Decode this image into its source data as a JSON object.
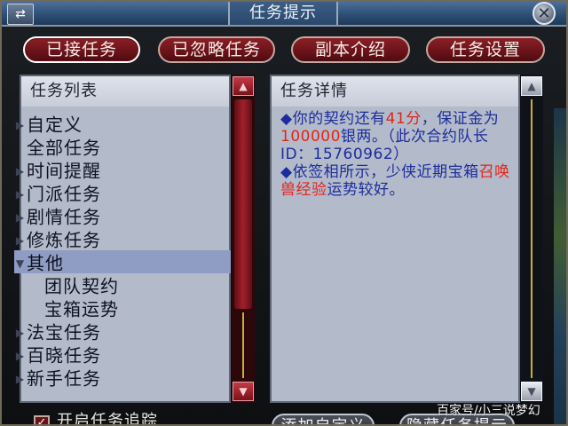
{
  "window": {
    "title": "任务提示"
  },
  "icons": {
    "menu": "swap-arrows-icon",
    "close": "close-icon",
    "collapsed": "triangle-right-icon",
    "expanded": "triangle-down-icon"
  },
  "tabs": [
    {
      "label": "已接任务",
      "active": true
    },
    {
      "label": "已忽略任务",
      "active": false
    },
    {
      "label": "副本介绍",
      "active": false
    },
    {
      "label": "任务设置",
      "active": false
    }
  ],
  "task_list": {
    "header": "任务列表",
    "items": [
      {
        "label": "自定义",
        "arrow": "▶",
        "indent": 0,
        "selected": false
      },
      {
        "label": "全部任务",
        "arrow": "",
        "indent": 0,
        "selected": false
      },
      {
        "label": "时间提醒",
        "arrow": "▶",
        "indent": 0,
        "selected": false
      },
      {
        "label": "门派任务",
        "arrow": "▶",
        "indent": 0,
        "selected": false
      },
      {
        "label": "剧情任务",
        "arrow": "▶",
        "indent": 0,
        "selected": false
      },
      {
        "label": "修炼任务",
        "arrow": "▶",
        "indent": 0,
        "selected": false
      },
      {
        "label": "其他",
        "arrow": "▼",
        "indent": 0,
        "selected": true
      },
      {
        "label": "团队契约",
        "arrow": "",
        "indent": 1,
        "selected": false
      },
      {
        "label": "宝箱运势",
        "arrow": "",
        "indent": 1,
        "selected": false
      },
      {
        "label": "法宝任务",
        "arrow": "▶",
        "indent": 0,
        "selected": false
      },
      {
        "label": "百晓任务",
        "arrow": "▶",
        "indent": 0,
        "selected": false
      },
      {
        "label": "新手任务",
        "arrow": "▶",
        "indent": 0,
        "selected": false
      }
    ]
  },
  "task_detail": {
    "header": "任务详情",
    "p1": {
      "bullet": "◆",
      "a": "你的契约还有",
      "b": "41分",
      "c": "，保证金为",
      "d": "100000",
      "e": "银两。（此次合约队长ID：15760962）"
    },
    "p2": {
      "bullet": "◆",
      "a": "依签相所示，少侠近期宝箱",
      "b": "召唤兽经验",
      "c": "运势较好。"
    }
  },
  "bottom": {
    "checkbox_label": "开启任务追踪",
    "checkbox_checked": true,
    "checkbox_mark": "✓",
    "btn_add": "添加自定义",
    "btn_hide": "隐藏任务提示"
  },
  "watermark": "百家号/小三说梦幻",
  "colors": {
    "accent_red": "#6a1219",
    "detail_blue": "#1d2c9a",
    "highlight_red": "#e2241c",
    "panel_bg": "#b3bbcb"
  }
}
